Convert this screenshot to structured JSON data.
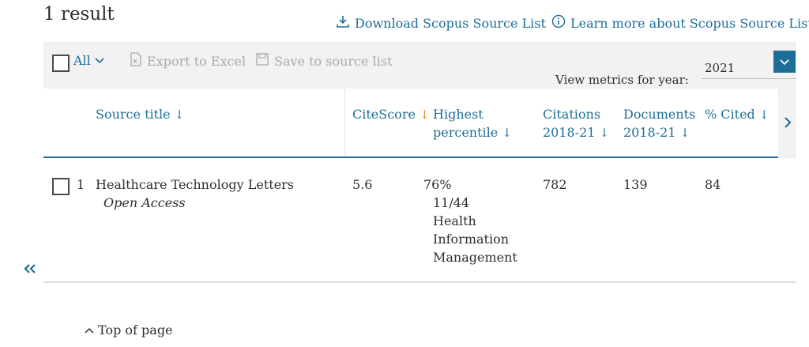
{
  "results": {
    "count_label": "1 result"
  },
  "top_links": {
    "download": "Download Scopus Source List",
    "learn_more": "Learn more about Scopus Source List"
  },
  "toolbar": {
    "select_all": "All",
    "export": "Export to Excel",
    "save": "Save to source list",
    "year_label": "View metrics for year:",
    "year_value": "2021"
  },
  "columns": {
    "source_title": "Source title",
    "citescore": "CiteScore",
    "highest_percentile_1": "Highest",
    "highest_percentile_2": "percentile",
    "citations_1": "Citations",
    "citations_2": "2018-21",
    "documents_1": "Documents",
    "documents_2": "2018-21",
    "pct_cited": "% Cited"
  },
  "rows": [
    {
      "index": "1",
      "title": "Healthcare Technology Letters",
      "access": "Open Access",
      "citescore": "5.6",
      "percentile": "76%",
      "rank": "11/44",
      "category_1": "Health",
      "category_2": "Information",
      "category_3": "Management",
      "citations": "782",
      "documents": "139",
      "pct_cited": "84"
    }
  ],
  "footer": {
    "top_of_page": "Top of page"
  },
  "colors": {
    "accent": "#1c6e97",
    "sort_active": "#e8811e",
    "toolbar_bg": "#f2f2f2"
  },
  "icons": [
    "download-icon",
    "info-icon",
    "chevron-down-icon",
    "excel-icon",
    "save-icon",
    "sort-arrow-icon",
    "chevron-right-icon",
    "double-chevron-left-icon",
    "caret-up-icon"
  ]
}
